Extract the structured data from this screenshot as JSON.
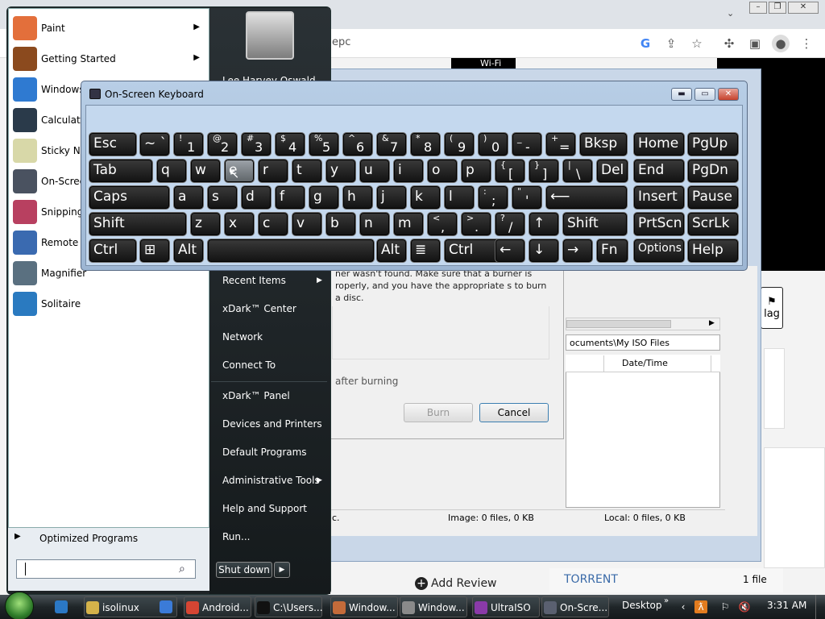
{
  "browser": {
    "url_fragment": "epc",
    "wifi_label": "Wi-Fi",
    "flag_label": "lag",
    "add_review": "Add Review",
    "torrent": "TORRENT",
    "file_count": "1 file"
  },
  "ultraiso": {
    "path": "ocuments\\My ISO Files",
    "col_date": "Date/Time",
    "status_left": "c.",
    "status_image": "Image: 0 files, 0 KB",
    "status_local": "Local: 0 files, 0 KB",
    "burn_message": "ner wasn't found. Make sure that a burner is roperly, and you have the appropriate s to burn a disc.",
    "after_burning": "after burning",
    "burn_button": "Burn",
    "cancel_button": "Cancel"
  },
  "start_menu": {
    "pinned": [
      {
        "label": "Paint",
        "icon": "paint-icon",
        "color": "#e36f3b",
        "arrow": true
      },
      {
        "label": "Getting Started",
        "icon": "getting-started-icon",
        "color": "#8b4a1e",
        "arrow": true
      },
      {
        "label": "Windows",
        "icon": "windows-media-icon",
        "color": "#2f7ad1",
        "arrow": false
      },
      {
        "label": "Calculato",
        "icon": "calculator-icon",
        "color": "#2a3a4a",
        "arrow": false
      },
      {
        "label": "Sticky No",
        "icon": "sticky-notes-icon",
        "color": "#d8d8a8",
        "arrow": false
      },
      {
        "label": "On-Scree",
        "icon": "on-screen-keyboard-icon",
        "color": "#4a5260",
        "arrow": false
      },
      {
        "label": "Snipping",
        "icon": "snipping-tool-icon",
        "color": "#b84060",
        "arrow": false
      },
      {
        "label": "Remote D",
        "icon": "remote-desktop-icon",
        "color": "#3a6ab0",
        "arrow": false
      },
      {
        "label": "Magnifier",
        "icon": "magnifier-icon",
        "color": "#5a7080",
        "arrow": false
      },
      {
        "label": "Solitaire",
        "icon": "solitaire-icon",
        "color": "#2a7ac0",
        "arrow": false
      }
    ],
    "all_programs": "Optimized Programs",
    "user_name": "Lee Harvey Oswald",
    "right_items": [
      {
        "label": "Recent Items",
        "arrow": true
      },
      {
        "label": "xDark™ Center",
        "arrow": false
      },
      {
        "label": "Network",
        "arrow": false
      },
      {
        "label": "Connect To",
        "arrow": false
      },
      {
        "label": "xDark™ Panel",
        "arrow": false
      },
      {
        "label": "Devices and Printers",
        "arrow": false
      },
      {
        "label": "Default Programs",
        "arrow": false
      },
      {
        "label": "Administrative Tools",
        "arrow": true
      },
      {
        "label": "Help and Support",
        "arrow": false
      },
      {
        "label": "Run...",
        "arrow": false
      }
    ],
    "shutdown": "Shut down"
  },
  "osk": {
    "title": "On-Screen Keyboard",
    "rows": [
      [
        {
          "m": "Esc"
        },
        {
          "m": "~ `"
        },
        {
          "s": "!",
          "p": "1"
        },
        {
          "s": "@",
          "p": "2"
        },
        {
          "s": "#",
          "p": "3"
        },
        {
          "s": "$",
          "p": "4"
        },
        {
          "s": "%",
          "p": "5"
        },
        {
          "s": "^",
          "p": "6"
        },
        {
          "s": "&",
          "p": "7"
        },
        {
          "s": "*",
          "p": "8"
        },
        {
          "s": "(",
          "p": "9"
        },
        {
          "s": ")",
          "p": "0"
        },
        {
          "s": "_",
          "p": "-"
        },
        {
          "s": "+",
          "p": "="
        },
        {
          "m": "Bksp"
        },
        {
          "m": "Home"
        },
        {
          "m": "PgUp"
        }
      ],
      [
        {
          "m": "Tab"
        },
        {
          "m": "q"
        },
        {
          "m": "w"
        },
        {
          "m": "e"
        },
        {
          "m": "r"
        },
        {
          "m": "t"
        },
        {
          "m": "y"
        },
        {
          "m": "u"
        },
        {
          "m": "i"
        },
        {
          "m": "o"
        },
        {
          "m": "p"
        },
        {
          "s": "{",
          "p": "["
        },
        {
          "s": "}",
          "p": "]"
        },
        {
          "s": "|",
          "p": "\\"
        },
        {
          "m": "Del"
        },
        {
          "m": "End"
        },
        {
          "m": "PgDn"
        }
      ],
      [
        {
          "m": "Caps"
        },
        {
          "m": "a"
        },
        {
          "m": "s"
        },
        {
          "m": "d"
        },
        {
          "m": "f"
        },
        {
          "m": "g"
        },
        {
          "m": "h"
        },
        {
          "m": "j"
        },
        {
          "m": "k"
        },
        {
          "m": "l"
        },
        {
          "s": ":",
          "p": ";"
        },
        {
          "s": "\"",
          "p": "'"
        },
        {
          "m": "⟵"
        },
        {
          "m": "Insert"
        },
        {
          "m": "Pause"
        }
      ],
      [
        {
          "m": "Shift"
        },
        {
          "m": "z"
        },
        {
          "m": "x"
        },
        {
          "m": "c"
        },
        {
          "m": "v"
        },
        {
          "m": "b"
        },
        {
          "m": "n"
        },
        {
          "m": "m"
        },
        {
          "s": "<",
          "p": ","
        },
        {
          "s": ">",
          "p": "."
        },
        {
          "s": "?",
          "p": "/"
        },
        {
          "m": "↑"
        },
        {
          "m": "Shift"
        },
        {
          "m": "PrtScn"
        },
        {
          "m": "ScrLk"
        }
      ],
      [
        {
          "m": "Ctrl"
        },
        {
          "m": "⊞"
        },
        {
          "m": "Alt"
        },
        {
          "m": ""
        },
        {
          "m": "Alt"
        },
        {
          "m": "≣"
        },
        {
          "m": "Ctrl"
        },
        {
          "m": "←"
        },
        {
          "m": "↓"
        },
        {
          "m": "→"
        },
        {
          "m": "Fn"
        },
        {
          "m": "Options"
        },
        {
          "m": "Help"
        }
      ]
    ]
  },
  "taskbar": {
    "items": [
      {
        "label": "",
        "icon": "internet-explorer-icon",
        "color": "#2b78c5"
      },
      {
        "label": "isolinux",
        "icon": "folder-icon",
        "color": "#d4b24a"
      },
      {
        "label": "",
        "icon": "music-icon",
        "color": "#3b7bd8"
      },
      {
        "label": "Android...",
        "icon": "chrome-icon",
        "color": "#d64533"
      },
      {
        "label": "C:\\Users...",
        "icon": "cmd-icon",
        "color": "#111111"
      },
      {
        "label": "Window...",
        "icon": "paint-icon",
        "color": "#c46b3a"
      },
      {
        "label": "Window...",
        "icon": "printer-icon",
        "color": "#8a8a8a"
      },
      {
        "label": "UltraISO",
        "icon": "ultraiso-icon",
        "color": "#8a3aa8"
      },
      {
        "label": "On-Scre...",
        "icon": "keyboard-icon",
        "color": "#5a6070"
      }
    ],
    "desktop": "Desktop",
    "clock": "3:31 AM"
  }
}
